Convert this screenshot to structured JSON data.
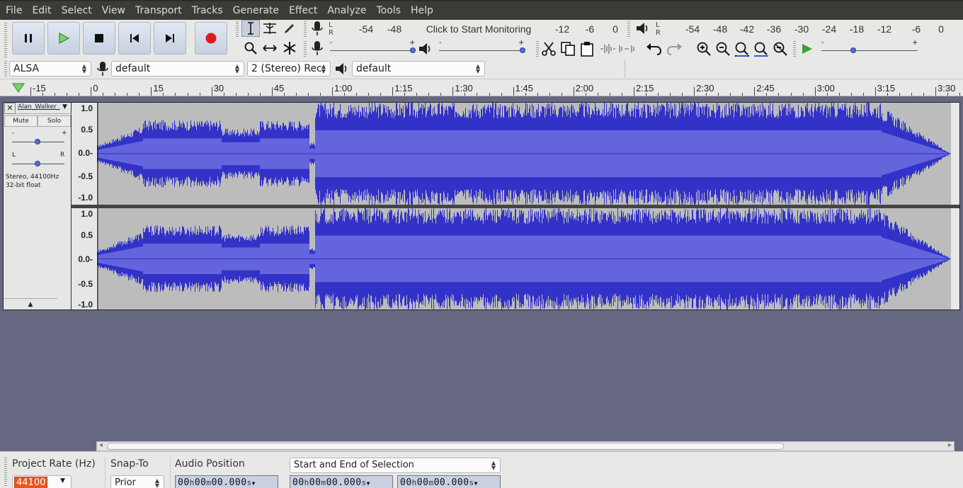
{
  "menubar": {
    "items": [
      "File",
      "Edit",
      "Select",
      "View",
      "Transport",
      "Tracks",
      "Generate",
      "Effect",
      "Analyze",
      "Tools",
      "Help"
    ]
  },
  "transport": {
    "pause": "pause-icon",
    "play": "play-icon",
    "stop": "stop-icon",
    "skip_start": "skip-to-start-icon",
    "skip_end": "skip-to-end-icon",
    "record": "record-icon",
    "record_color": "#e01b1b",
    "play_color": "#3ca02e"
  },
  "record_meter": {
    "l": "L",
    "r": "R",
    "scale": [
      "-54",
      "-48",
      "-12",
      "-6",
      "0"
    ],
    "prompt": "Click to Start Monitoring"
  },
  "playback_meter": {
    "l": "L",
    "r": "R",
    "scale": [
      "-54",
      "-48",
      "-42",
      "-36",
      "-30",
      "-24",
      "-18",
      "-12",
      "-6",
      "0"
    ]
  },
  "mixer": {
    "minus": "-",
    "plus": "+"
  },
  "device": {
    "host": "ALSA",
    "recording_device": "default",
    "channels": "2 (Stereo) Rec",
    "playback_device": "default"
  },
  "ruler": {
    "labels": [
      "-15",
      "0",
      "15",
      "30",
      "45",
      "1:00",
      "1:15",
      "1:30",
      "1:45",
      "2:00",
      "2:15",
      "2:30",
      "2:45",
      "3:00",
      "3:15",
      "3:30"
    ]
  },
  "track": {
    "name": "Alan_Walker_",
    "mute": "Mute",
    "solo": "Solo",
    "gain_minus": "-",
    "gain_plus": "+",
    "pan_left": "L",
    "pan_right": "R",
    "info_line1": "Stereo, 44100Hz",
    "info_line2": "32-bit float",
    "scale": [
      "1.0",
      "0.5",
      "0.0-",
      "-0.5",
      "-1.0"
    ],
    "waveform_color": "#3232c8",
    "rms_color": "#6464dc"
  },
  "bottom": {
    "project_rate_label": "Project Rate (Hz)",
    "project_rate_value": "44100",
    "snap_label": "Snap-To",
    "snap_value": "Prior",
    "audio_position_label": "Audio Position",
    "selection_mode": "Start and End of Selection",
    "time": {
      "hh": "00",
      "mm": "00",
      "ss": "00.000",
      "h": "h",
      "m": "m",
      "s": "s"
    }
  }
}
